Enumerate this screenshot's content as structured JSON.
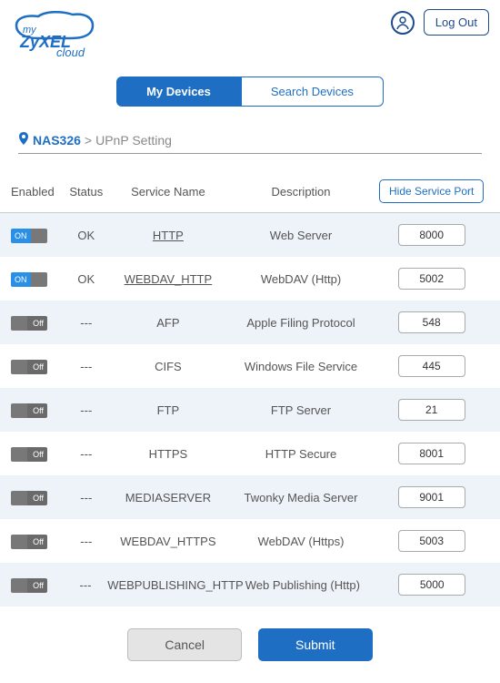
{
  "header": {
    "logout_label": "Log Out"
  },
  "tabs": [
    {
      "label": "My Devices",
      "active": true
    },
    {
      "label": "Search Devices",
      "active": false
    }
  ],
  "breadcrumb": {
    "device": "NAS326",
    "sep": ">",
    "current": "UPnP Setting"
  },
  "columns": {
    "enabled": "Enabled",
    "status": "Status",
    "service": "Service Name",
    "description": "Description",
    "hide_port": "Hide Service Port"
  },
  "rows": [
    {
      "enabled": true,
      "status": "OK",
      "service": "HTTP",
      "link": true,
      "desc": "Web Server",
      "port": "8000"
    },
    {
      "enabled": true,
      "status": "OK",
      "service": "WEBDAV_HTTP",
      "link": true,
      "desc": "WebDAV (Http)",
      "port": "5002"
    },
    {
      "enabled": false,
      "status": "---",
      "service": "AFP",
      "link": false,
      "desc": "Apple Filing Protocol",
      "port": "548"
    },
    {
      "enabled": false,
      "status": "---",
      "service": "CIFS",
      "link": false,
      "desc": "Windows File Service",
      "port": "445"
    },
    {
      "enabled": false,
      "status": "---",
      "service": "FTP",
      "link": false,
      "desc": "FTP Server",
      "port": "21"
    },
    {
      "enabled": false,
      "status": "---",
      "service": "HTTPS",
      "link": false,
      "desc": "HTTP Secure",
      "port": "8001"
    },
    {
      "enabled": false,
      "status": "---",
      "service": "MEDIASERVER",
      "link": false,
      "desc": "Twonky Media Server",
      "port": "9001"
    },
    {
      "enabled": false,
      "status": "---",
      "service": "WEBDAV_HTTPS",
      "link": false,
      "desc": "WebDAV (Https)",
      "port": "5003"
    },
    {
      "enabled": false,
      "status": "---",
      "service": "WEBPUBLISHING_HTTP",
      "link": false,
      "desc": "Web Publishing (Http)",
      "port": "5000"
    }
  ],
  "footer": {
    "cancel": "Cancel",
    "submit": "Submit"
  },
  "toggle_labels": {
    "on": "ON",
    "off": "Off"
  }
}
